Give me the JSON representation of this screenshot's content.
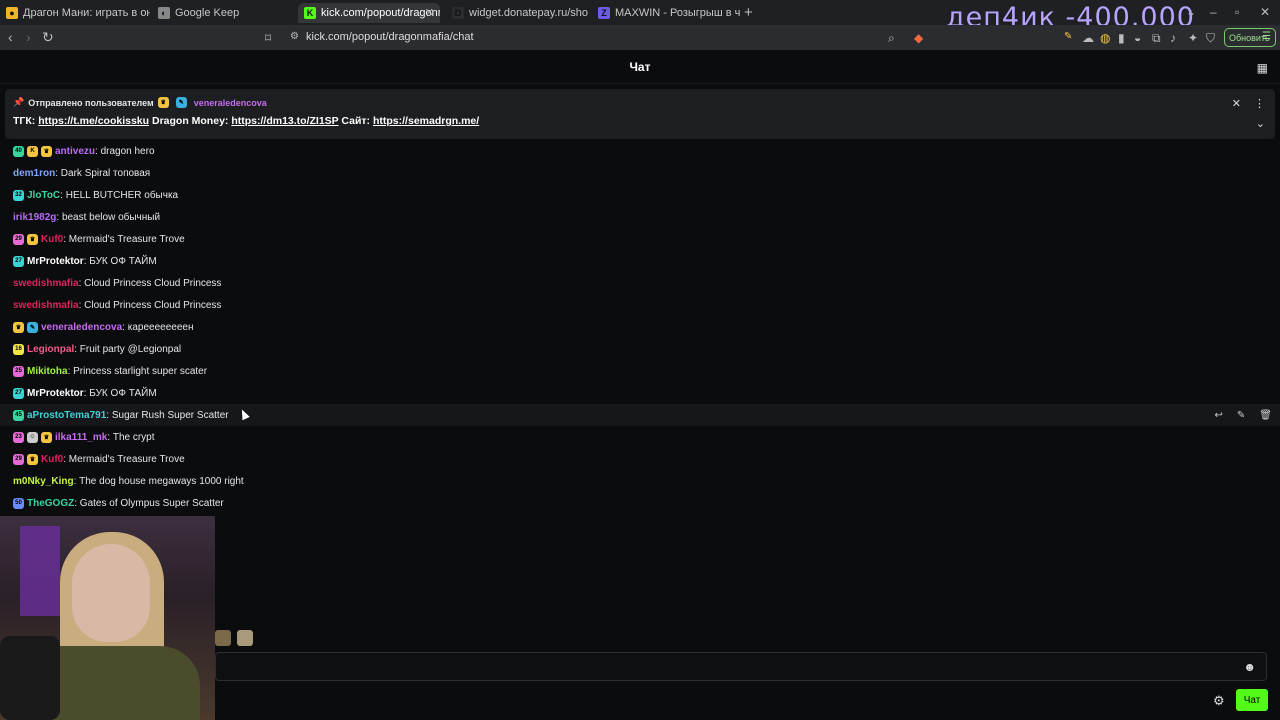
{
  "browser": {
    "tabs": [
      {
        "label": "Драгон Мани: играть в онлайн каз…",
        "fav_color": "#f0b429",
        "fav_glyph": "●"
      },
      {
        "label": "Google Keep",
        "fav_color": "#888888",
        "fav_glyph": "◐"
      },
      {
        "label": "kick.com/popout/dragonmafia/…",
        "fav_color": "#53fc18",
        "fav_glyph": "K"
      },
      {
        "label": "widget.donatepay.ru/showplayer…",
        "fav_color": "#2b2c30",
        "fav_glyph": "D"
      },
      {
        "label": "MAXWIN - Розыгрыш в чате Kick",
        "fav_color": "#6c5ce7",
        "fav_glyph": "Z"
      }
    ],
    "url": "kick.com/popout/dragonmafia/chat",
    "update_label": "Обновить"
  },
  "overlay": {
    "text": "деп4ик -400.000"
  },
  "chat": {
    "title": "Чат",
    "pinned": {
      "sent_by": "Отправлено пользователем",
      "author": "veneraledencova",
      "author_color": "#c56cf0",
      "tgk_label": "ТГК:",
      "tgk_link": "https://t.me/cookissku",
      "money_label": "Dragon Money:",
      "money_link": "https://dm13.to/ZI1SP",
      "site_label": "Сайт:",
      "site_link": "https://semadrgn.me/"
    },
    "messages": [
      {
        "badges": [
          {
            "c": "#3ad4a1",
            "t": "40"
          },
          {
            "c": "#f5c542",
            "t": "K"
          },
          {
            "c": "#f5c542",
            "t": "♛"
          }
        ],
        "user": "antivezu",
        "color": "#b96cf5",
        "text": "dragon hero"
      },
      {
        "badges": [],
        "user": "dem1ron",
        "color": "#7fa8ff",
        "text": "Dark Spiral топовая"
      },
      {
        "badges": [
          {
            "c": "#3ad4d4",
            "t": "32"
          }
        ],
        "user": "JloToC",
        "color": "#3ad4a1",
        "text": "HELL BUTCHER обычка"
      },
      {
        "badges": [],
        "user": "irik1982g",
        "color": "#b96cf5",
        "text": "beast below обычный"
      },
      {
        "badges": [
          {
            "c": "#e66ad6",
            "t": "29"
          },
          {
            "c": "#f5c542",
            "t": "♛"
          }
        ],
        "user": "Kuf0",
        "color": "#e0245e",
        "text": "Mermaid's Treasure Trove"
      },
      {
        "badges": [
          {
            "c": "#3ad4d4",
            "t": "27"
          }
        ],
        "user": "MrProtektor",
        "color": "#ffffff",
        "text": "БУК ОФ ТАЙМ"
      },
      {
        "badges": [],
        "user": "swedishmafia",
        "color": "#e0245e",
        "text": "Cloud Princess Cloud Princess"
      },
      {
        "badges": [],
        "user": "swedishmafia",
        "color": "#e0245e",
        "text": "Cloud Princess Cloud Princess"
      },
      {
        "badges": [
          {
            "c": "#f5c542",
            "t": "♛"
          },
          {
            "c": "#3ab0e0",
            "t": "✎"
          }
        ],
        "user": "veneraledencova",
        "color": "#c56cf0",
        "text": "кареееееееен"
      },
      {
        "badges": [
          {
            "c": "#f5e542",
            "t": "16"
          }
        ],
        "user": "Legionpal",
        "color": "#f55a8a",
        "text": "Fruit party @Legionpal"
      },
      {
        "badges": [
          {
            "c": "#e66ad6",
            "t": "25"
          }
        ],
        "user": "Mikitoha",
        "color": "#9ef542",
        "text": "Princess starlight super scater"
      },
      {
        "badges": [
          {
            "c": "#3ad4d4",
            "t": "27"
          }
        ],
        "user": "MrProtektor",
        "color": "#ffffff",
        "text": "БУК ОФ ТАЙМ"
      },
      {
        "badges": [
          {
            "c": "#3ad4a1",
            "t": "45"
          }
        ],
        "user": "aProstoTema791",
        "color": "#3ad4d4",
        "text": "Sugar Rush Super Scatter"
      },
      {
        "badges": [
          {
            "c": "#e66ad6",
            "t": "23"
          },
          {
            "c": "#cccccc",
            "t": "☺"
          },
          {
            "c": "#f5c542",
            "t": "♛"
          }
        ],
        "user": "ilka111_mk",
        "color": "#c56cf0",
        "text": "The crypt"
      },
      {
        "badges": [
          {
            "c": "#e66ad6",
            "t": "29"
          },
          {
            "c": "#f5c542",
            "t": "♛"
          }
        ],
        "user": "Kuf0",
        "color": "#e0245e",
        "text": "Mermaid's Treasure Trove"
      },
      {
        "badges": [],
        "user": "m0Nky_King",
        "color": "#c5f542",
        "text": "The dog house megaways 1000 right"
      },
      {
        "badges": [
          {
            "c": "#6a8cff",
            "t": "50"
          }
        ],
        "user": "TheGOGZ",
        "color": "#3ad4a1",
        "text": "Gates of Olympus Super Scatter"
      }
    ],
    "hover_index": 12,
    "send_label": "Чат",
    "accent": "#53fc18"
  }
}
